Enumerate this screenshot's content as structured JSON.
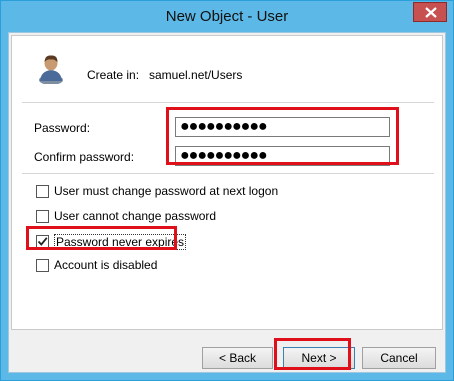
{
  "window": {
    "title": "New Object - User"
  },
  "header": {
    "create_in_label": "Create in:",
    "create_in_value": "samuel.net/Users"
  },
  "form": {
    "password_label": "Password:",
    "password_value": "●●●●●●●●●●",
    "confirm_label": "Confirm password:",
    "confirm_value": "●●●●●●●●●●"
  },
  "options": [
    {
      "label": "User must change password at next logon",
      "checked": false
    },
    {
      "label": "User cannot change password",
      "checked": false
    },
    {
      "label": "Password never expires",
      "checked": true
    },
    {
      "label": "Account is disabled",
      "checked": false
    }
  ],
  "buttons": {
    "back": "< Back",
    "next": "Next >",
    "cancel": "Cancel"
  },
  "colors": {
    "titlebar": "#5cb8e6",
    "close": "#c75050",
    "highlight": "#e0101a"
  }
}
